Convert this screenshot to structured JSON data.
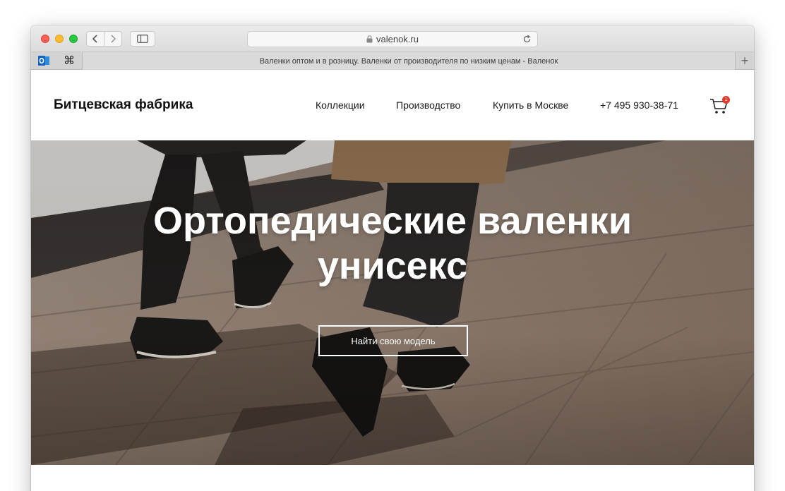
{
  "browser": {
    "url": "valenok.ru",
    "tab_title": "Валенки оптом и в розницу. Валенки от производителя по низким ценам - Валенок",
    "icons": [
      "back-icon",
      "forward-icon",
      "sidebar-icon",
      "lock-icon",
      "reload-icon",
      "outlook-icon",
      "command-icon",
      "new-tab-icon"
    ],
    "new_tab_label": "+",
    "cmd_glyph": "⌘"
  },
  "header": {
    "logo": "Битцевская фабрика",
    "nav": [
      "Коллекции",
      "Производство",
      "Купить в Москве"
    ],
    "phone": "+7 495 930-38-71",
    "cart_count": "1"
  },
  "hero": {
    "title_line1": "Ортопедические валенки",
    "title_line2": "унисекс",
    "button": "Найти свою модель"
  },
  "colors": {
    "accent_red": "#e23b2d",
    "text_dark": "#111111"
  }
}
